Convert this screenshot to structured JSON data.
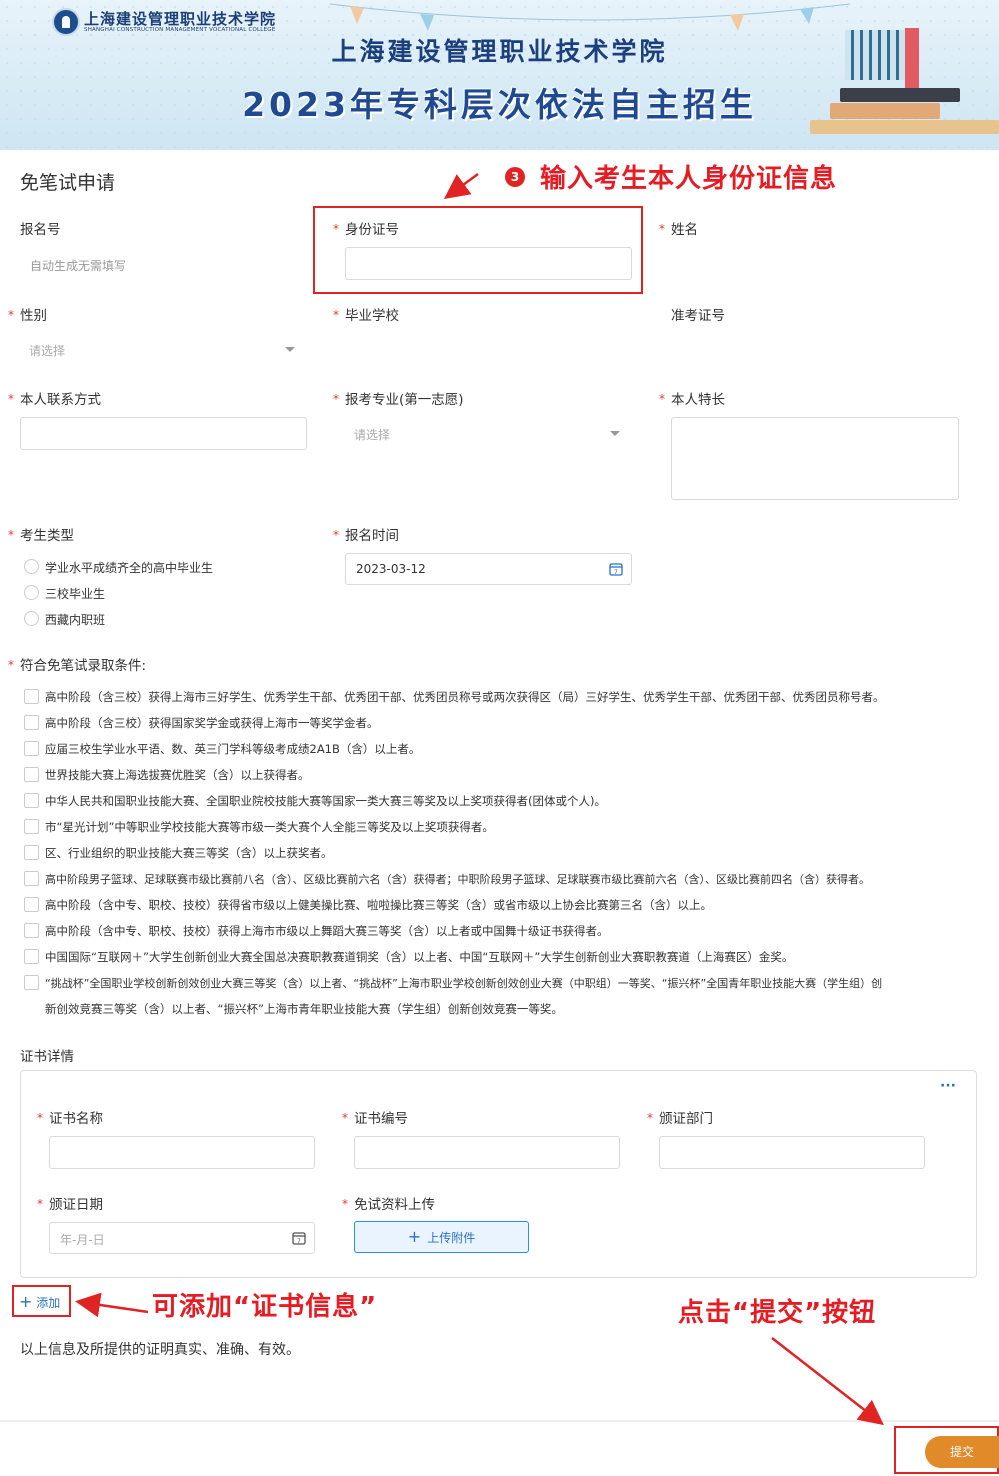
{
  "header": {
    "logo_cn": "上海建设管理职业技术学院",
    "logo_en": "SHANGHAI CONSTRUCTION MANAGEMENT VOCATIONAL COLLEGE",
    "title1": "上海建设管理职业技术学院",
    "title2": "2023年专科层次依法自主招生"
  },
  "form": {
    "section_title": "免笔试申请",
    "reg_no": {
      "label": "报名号",
      "hint": "自动生成无需填写"
    },
    "id_card": {
      "label": "身份证号",
      "value": ""
    },
    "name": {
      "label": "姓名"
    },
    "gender": {
      "label": "性别",
      "placeholder": "请选择"
    },
    "school": {
      "label": "毕业学校"
    },
    "exam_no": {
      "label": "准考证号"
    },
    "contact": {
      "label": "本人联系方式",
      "value": ""
    },
    "major": {
      "label": "报考专业(第一志愿)",
      "placeholder": "请选择"
    },
    "specialty": {
      "label": "本人特长",
      "value": ""
    },
    "candidate_type": {
      "label": "考生类型",
      "options": [
        "学业水平成绩齐全的高中毕业生",
        "三校毕业生",
        "西藏内职班"
      ]
    },
    "reg_time": {
      "label": "报名时间",
      "value": "2023-03-12"
    },
    "conditions": {
      "label": "符合免笔试录取条件:",
      "items": [
        "高中阶段（含三校）获得上海市三好学生、优秀学生干部、优秀团干部、优秀团员称号或两次获得区（局）三好学生、优秀学生干部、优秀团干部、优秀团员称号者。",
        "高中阶段（含三校）获得国家奖学金或获得上海市一等奖学金者。",
        "应届三校生学业水平语、数、英三门学科等级考成绩2A1B（含）以上者。",
        "世界技能大赛上海选拔赛优胜奖（含）以上获得者。",
        "中华人民共和国职业技能大赛、全国职业院校技能大赛等国家一类大赛三等奖及以上奖项获得者(团体或个人)。",
        "市“星光计划”中等职业学校技能大赛等市级一类大赛个人全能三等奖及以上奖项获得者。",
        "区、行业组织的职业技能大赛三等奖（含）以上获奖者。",
        "高中阶段男子篮球、足球联赛市级比赛前八名（含）、区级比赛前六名（含）获得者；中职阶段男子篮球、足球联赛市级比赛前六名（含）、区级比赛前四名（含）获得者。",
        "高中阶段（含中专、职校、技校）获得省市级以上健美操比赛、啦啦操比赛三等奖（含）或省市级以上协会比赛第三名（含）以上。",
        "高中阶段（含中专、职校、技校）获得上海市市级以上舞蹈大赛三等奖（含）以上者或中国舞十级证书获得者。",
        "中国国际“互联网＋”大学生创新创业大赛全国总决赛职教赛道铜奖（含）以上者、中国“互联网＋”大学生创新创业大赛职教赛道（上海赛区）金奖。"
      ],
      "last_line1": "“挑战杯”全国职业学校创新创效创业大赛三等奖（含）以上者、“挑战杯”上海市职业学校创新创效创业大赛（中职组）一等奖、“振兴杯”全国青年职业技能大赛（学生组）创",
      "last_line2": "新创效竞赛三等奖（含）以上者、“振兴杯”上海市青年职业技能大赛（学生组）创新创效竞赛一等奖。"
    },
    "cert": {
      "section_label": "证书详情",
      "more": "···",
      "name_label": "证书名称",
      "no_label": "证书编号",
      "dept_label": "颁证部门",
      "date_label": "颁证日期",
      "date_placeholder": "年-月-日",
      "upload_label": "免试资料上传",
      "upload_btn": "上传附件"
    },
    "add_btn": "添加",
    "statement": "以上信息及所提供的证明真实、准确、有效。",
    "submit": "提交"
  },
  "annotations": {
    "step_no": "3",
    "id_hint": "输入考生本人身份证信息",
    "add_hint": "可添加“证书信息”",
    "submit_hint": "点击“提交”按钮"
  }
}
